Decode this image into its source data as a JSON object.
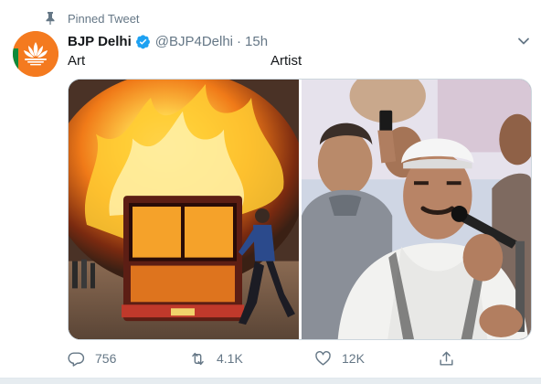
{
  "pinned": {
    "label": "Pinned Tweet",
    "icon": "pin-icon"
  },
  "author": {
    "name": "BJP Delhi",
    "handle": "@BJP4Delhi",
    "separator": "·",
    "time": "15h",
    "verified_icon": "verified-badge-icon",
    "avatar_icon": "lotus-logo-icon"
  },
  "tweet": {
    "text_left": "Art",
    "text_right": "Artist"
  },
  "media": {
    "left_image": "burning-bus-photo",
    "right_image": "man-speaking-into-microphone-photo"
  },
  "actions": {
    "reply": {
      "icon": "reply-icon",
      "count": "756"
    },
    "retweet": {
      "icon": "retweet-icon",
      "count": "4.1K"
    },
    "like": {
      "icon": "heart-icon",
      "count": "12K"
    },
    "share": {
      "icon": "share-icon"
    }
  },
  "colors": {
    "text_primary": "#14171a",
    "text_secondary": "#657786",
    "verified_blue": "#1da1f2",
    "avatar_orange": "#f47a1f"
  }
}
